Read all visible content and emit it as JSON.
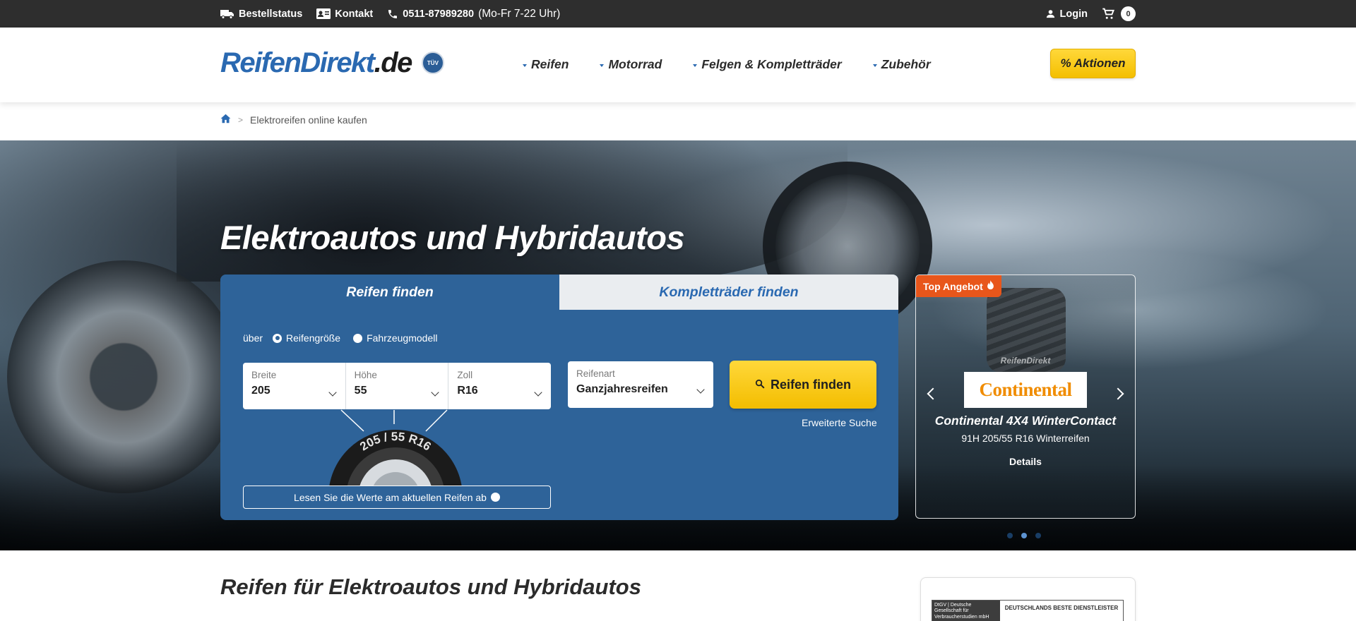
{
  "topbar": {
    "order_status": "Bestellstatus",
    "contact": "Kontakt",
    "phone": "0511-87989280",
    "hours": "(Mo-Fr 7-22 Uhr)",
    "login": "Login",
    "cart_count": "0"
  },
  "header": {
    "logo_main": "ReifenDirekt",
    "logo_tld": ".de",
    "tuv_badge": "TÜV",
    "nav": [
      {
        "label": "Reifen"
      },
      {
        "label": "Motorrad"
      },
      {
        "label": "Felgen & Kompletträder"
      },
      {
        "label": "Zubehör"
      }
    ],
    "promo_label": "% Aktionen"
  },
  "breadcrumb": {
    "separator": ">",
    "current": "Elektroreifen online kaufen"
  },
  "hero": {
    "title": "Elektroautos und Hybridautos"
  },
  "search": {
    "tabs": [
      {
        "label": "Reifen finden",
        "active": true
      },
      {
        "label": "Kompletträder finden",
        "active": false
      }
    ],
    "via_label": "über",
    "radio_options": [
      {
        "label": "Reifengröße",
        "selected": true
      },
      {
        "label": "Fahrzeugmodell",
        "selected": false
      }
    ],
    "fields": [
      {
        "label": "Breite",
        "value": "205"
      },
      {
        "label": "Höhe",
        "value": "55"
      },
      {
        "label": "Zoll",
        "value": "R16"
      }
    ],
    "type_field": {
      "label": "Reifenart",
      "value": "Ganzjahresreifen"
    },
    "find_button": "Reifen finden",
    "advanced_link": "Erweiterte Suche",
    "tire_marking": "205 / 55 R16",
    "read_values_button": "Lesen Sie die Werte am aktuellen Reifen ab"
  },
  "offer": {
    "badge": "Top Angebot",
    "tire_watermark": "ReifenDirekt",
    "brand": "Continental",
    "name": "Continental 4X4 WinterContact",
    "spec": "91H 205/55 R16 Winterreifen",
    "details_link": "Details",
    "active_slide": 2,
    "slide_count": 3
  },
  "content": {
    "section_title": "Reifen für Elektroautos und Hybridautos",
    "seal_left": "DtGV | Deutsche Gesellschaft für Verbraucherstudien mbH",
    "seal_right": "DEUTSCHLANDS BESTE DIENSTLEISTER"
  },
  "colors": {
    "brand_blue": "#2a69b1",
    "panel_blue": "#2e6399",
    "accent_yellow": "#f4bf00",
    "badge_orange": "#e8561b",
    "topbar_dark": "#2e2e2e"
  }
}
